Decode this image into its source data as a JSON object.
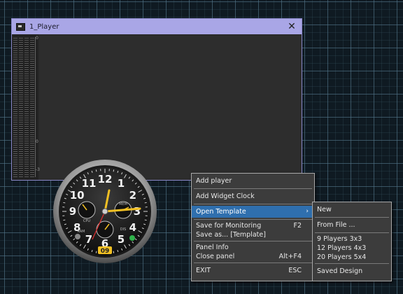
{
  "player_window": {
    "title": "1_Player",
    "close_glyph": "✕",
    "meter_ticks": [
      "0",
      "0",
      "-3"
    ]
  },
  "widget_clock": {
    "numerals": [
      "12",
      "1",
      "2",
      "3",
      "4",
      "5",
      "6",
      "7",
      "8",
      "9",
      "10",
      "11"
    ],
    "subdial_labels": [
      "CPU",
      "MEM",
      "RAM",
      "DIS"
    ],
    "date": "09"
  },
  "context_menu": {
    "items": [
      {
        "label": "Add player",
        "shortcut": ""
      },
      {
        "label": "Add Widget Clock",
        "shortcut": ""
      },
      {
        "label": "Open Template",
        "shortcut": "",
        "submenu_arrow": "›"
      },
      {
        "label": "Save for Monitoring",
        "shortcut": "F2"
      },
      {
        "label": "Save as... [Template]",
        "shortcut": ""
      },
      {
        "label": "Panel Info",
        "shortcut": ""
      },
      {
        "label": "Close panel",
        "shortcut": "Alt+F4"
      },
      {
        "label": "EXIT",
        "shortcut": "ESC"
      }
    ]
  },
  "submenu": {
    "items": [
      "New",
      "From File ...",
      "9 Players 3x3",
      "12 Players 4x3",
      "20 Players 5x4",
      "Saved Design"
    ]
  },
  "colors": {
    "title_bar": "#a9a6e6",
    "menu_bg": "#3c3c3c",
    "highlight": "#2f6fae",
    "grid": "#54788c"
  }
}
